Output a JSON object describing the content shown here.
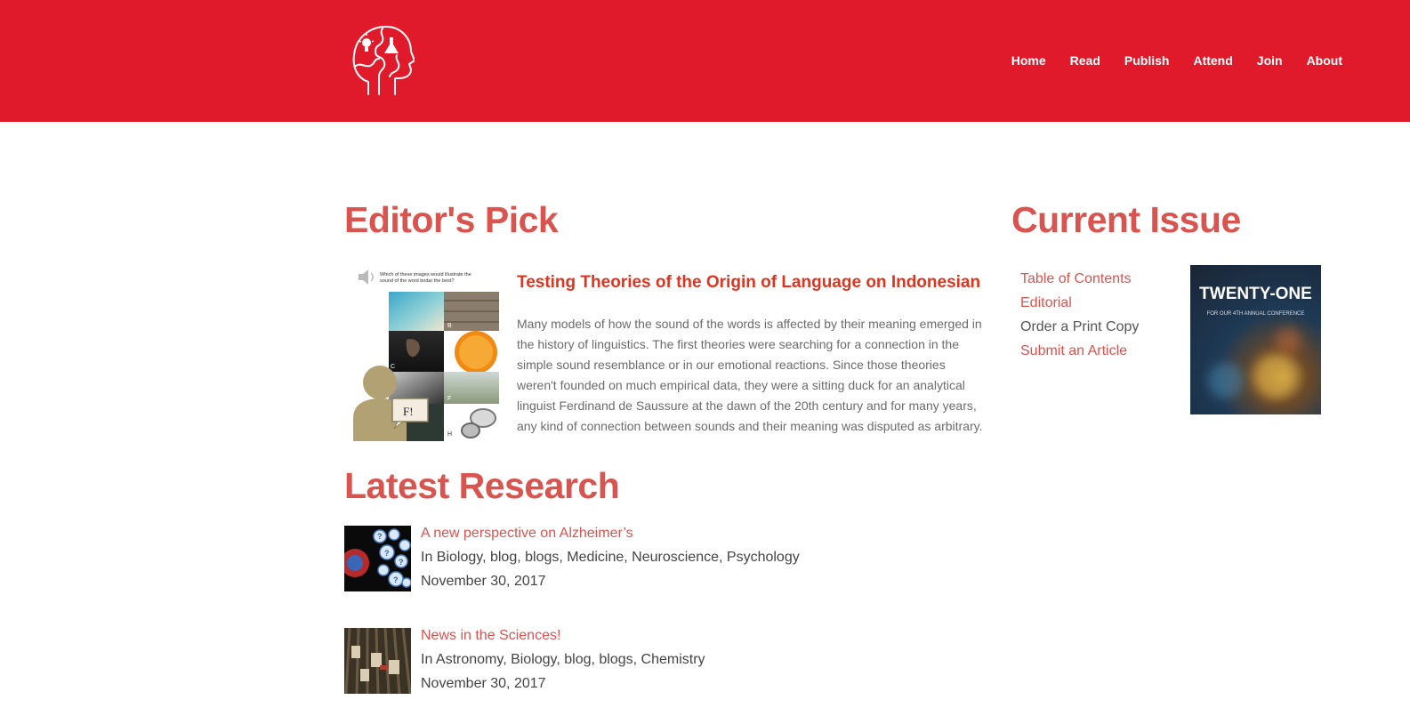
{
  "nav": {
    "items": [
      "Home",
      "Read",
      "Publish",
      "Attend",
      "Join",
      "About"
    ]
  },
  "editors_pick": {
    "heading": "Editor's Pick",
    "article_title": "Testing Theories of the Origin of Language on Indonesian",
    "excerpt": "Many models of how the sound of the words is affected by their meaning emerged in the history of linguistics. The first theories were searching for a connection in the simple sound resemblance or in our emotional reactions. Since those theories weren't founded on much empirical data, they were a sitting duck for an analytical linguist Ferdinand de Saussure at the dawn of the 20th century and for many years, any kind of connection between sounds and their meaning was disputed as arbitrary.",
    "image_prompt": "Which of these images would illustrate the sound of the word bodar the best?",
    "image_speech": "F!"
  },
  "current_issue": {
    "heading": "Current Issue",
    "links": [
      "Table of Contents",
      "Editorial",
      "Order a Print Copy",
      "Submit an Article"
    ],
    "cover_title": "TWENTY-ONE",
    "cover_subtitle": "FOR OUR 4TH ANNUAL CONFERENCE"
  },
  "latest_research": {
    "heading": "Latest Research",
    "items": [
      {
        "title": "A new perspective on Alzheimer’s",
        "categories": "In Biology, blog, blogs, Medicine, Neuroscience, Psychology",
        "date": "November 30, 2017"
      },
      {
        "title": "News in the Sciences!",
        "categories": "In Astronomy, Biology, blog, blogs, Chemistry",
        "date": "November 30, 2017"
      }
    ]
  },
  "colors": {
    "header_bg": "#e01a2a",
    "heading": "#d9534f",
    "link": "#d9534f"
  }
}
